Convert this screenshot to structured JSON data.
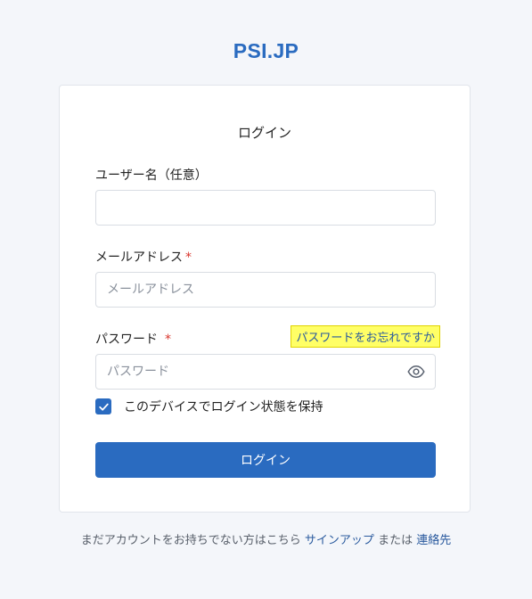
{
  "brand": {
    "name": "PSI.JP"
  },
  "login": {
    "title": "ログイン",
    "username": {
      "label": "ユーザー名（任意）",
      "value": "",
      "placeholder": ""
    },
    "email": {
      "label": "メールアドレス",
      "required_mark": "*",
      "value": "",
      "placeholder": "メールアドレス"
    },
    "password": {
      "label": "パスワード",
      "required_mark": "*",
      "value": "",
      "placeholder": "パスワード",
      "toggle_icon": "eye-icon"
    },
    "forgot_password": "パスワードをお忘れですか",
    "remember_me": {
      "label": "このデバイスでログイン状態を保持",
      "checked": true
    },
    "submit_label": "ログイン"
  },
  "footer": {
    "prefix": "まだアカウントをお持ちでない方はこちら",
    "signup_label": "サインアップ",
    "connector": "または",
    "contact_label": "連絡先"
  },
  "colors": {
    "accent": "#2a6bc0",
    "background": "#f4f6fa",
    "required": "#d9342b",
    "highlight": "#ffff66"
  }
}
